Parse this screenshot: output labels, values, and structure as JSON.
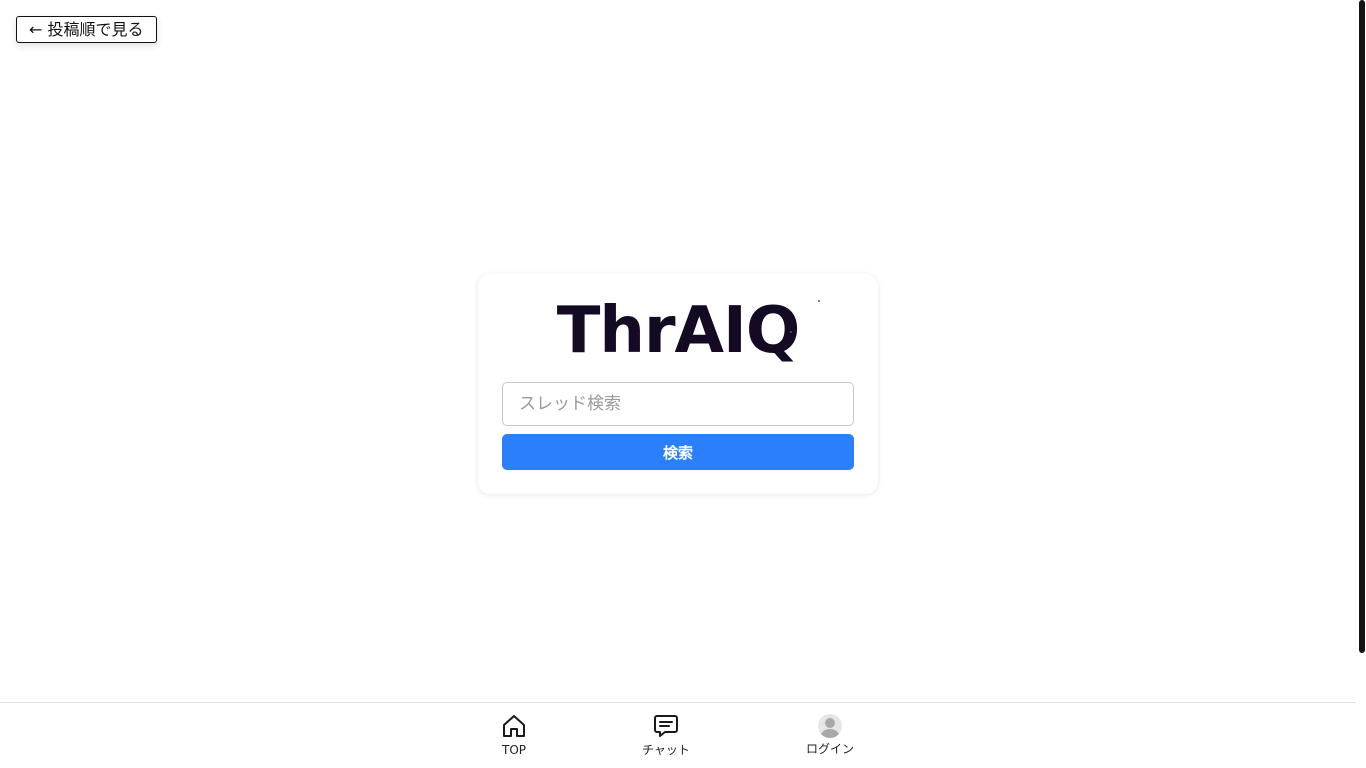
{
  "header": {
    "back_button_label": "← 投稿順で見る"
  },
  "search_card": {
    "logo_text": "ThrAIQ",
    "search_placeholder": "スレッド検索",
    "search_value": "",
    "search_button_label": "検索",
    "accent_color": "#2b7ffb"
  },
  "bottom_nav": {
    "items": [
      {
        "label": "TOP",
        "icon": "home-icon"
      },
      {
        "label": "チャット",
        "icon": "chat-icon"
      },
      {
        "label": "ログイン",
        "icon": "avatar-icon"
      }
    ]
  }
}
